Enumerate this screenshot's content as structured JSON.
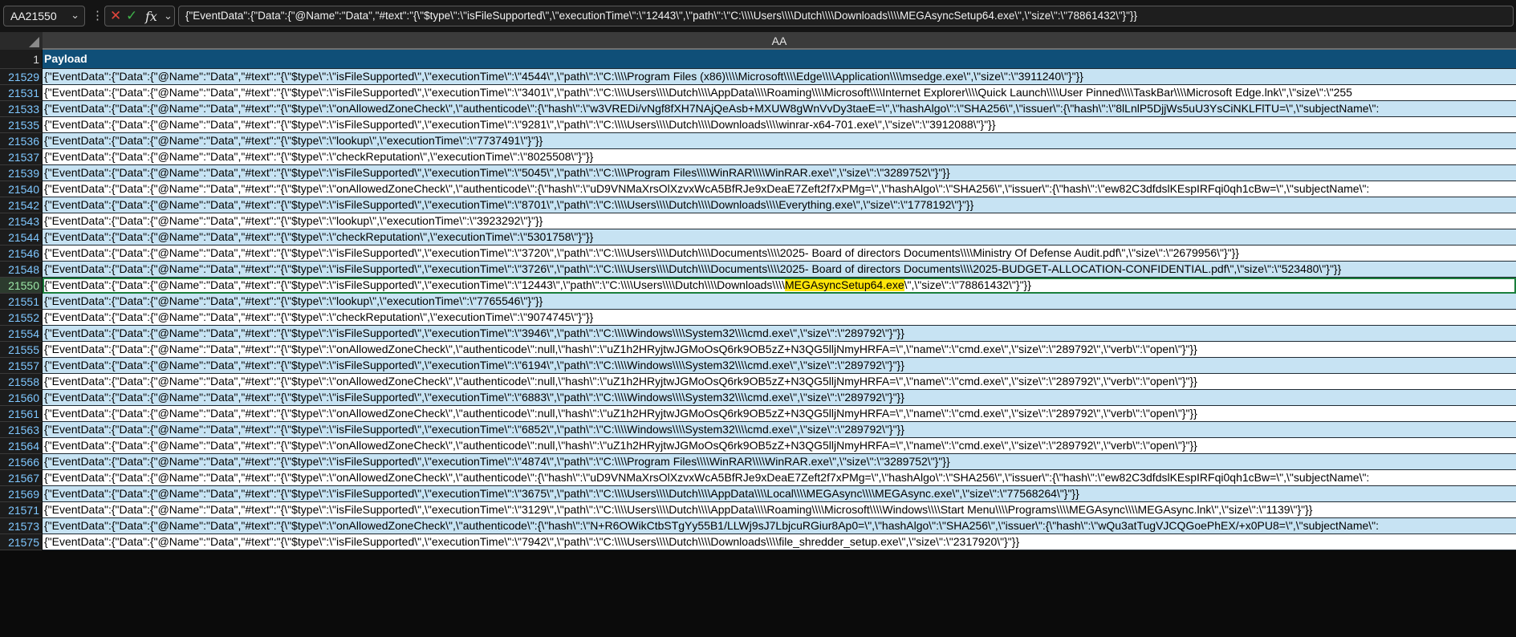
{
  "formula_bar": {
    "name_box": "AA21550",
    "formula": "{\"EventData\":{\"Data\":{\"@Name\":\"Data\",\"#text\":\"{\\\"$type\\\":\\\"isFileSupported\\\",\\\"executionTime\\\":\\\"12443\\\",\\\"path\\\":\\\"C:\\\\\\\\Users\\\\\\\\Dutch\\\\\\\\Downloads\\\\\\\\MEGAsyncSetup64.exe\\\",\\\"size\\\":\\\"78861432\\\"}\"}}"
  },
  "grid": {
    "column_letter": "AA",
    "header_row_number": "1",
    "header_label": "Payload",
    "active_row": "21550",
    "highlight_text": "MEGAsyncSetup64.exe",
    "rows": [
      {
        "num": "21529",
        "style": "blue",
        "text": "{\"EventData\":{\"Data\":{\"@Name\":\"Data\",\"#text\":\"{\\\"$type\\\":\\\"isFileSupported\\\",\\\"executionTime\\\":\\\"4544\\\",\\\"path\\\":\\\"C:\\\\\\\\Program Files (x86)\\\\\\\\Microsoft\\\\\\\\Edge\\\\\\\\Application\\\\\\\\msedge.exe\\\",\\\"size\\\":\\\"3911240\\\"}\"}}"
      },
      {
        "num": "21531",
        "style": "white",
        "text": "{\"EventData\":{\"Data\":{\"@Name\":\"Data\",\"#text\":\"{\\\"$type\\\":\\\"isFileSupported\\\",\\\"executionTime\\\":\\\"3401\\\",\\\"path\\\":\\\"C:\\\\\\\\Users\\\\\\\\Dutch\\\\\\\\AppData\\\\\\\\Roaming\\\\\\\\Microsoft\\\\\\\\Internet Explorer\\\\\\\\Quick Launch\\\\\\\\User Pinned\\\\\\\\TaskBar\\\\\\\\Microsoft Edge.lnk\\\",\\\"size\\\":\\\"255"
      },
      {
        "num": "21533",
        "style": "blue",
        "text": "{\"EventData\":{\"Data\":{\"@Name\":\"Data\",\"#text\":\"{\\\"$type\\\":\\\"onAllowedZoneCheck\\\",\\\"authenticode\\\":{\\\"hash\\\":\\\"w3VREDi/vNgf8fXH7NAjQeAsb+MXUW8gWnVvDy3taeE=\\\",\\\"hashAlgo\\\":\\\"SHA256\\\",\\\"issuer\\\":{\\\"hash\\\":\\\"8lLnlP5DjjWs5uU3YsCiNKLFlTU=\\\",\\\"subjectName\\\":"
      },
      {
        "num": "21535",
        "style": "white",
        "text": "{\"EventData\":{\"Data\":{\"@Name\":\"Data\",\"#text\":\"{\\\"$type\\\":\\\"isFileSupported\\\",\\\"executionTime\\\":\\\"9281\\\",\\\"path\\\":\\\"C:\\\\\\\\Users\\\\\\\\Dutch\\\\\\\\Downloads\\\\\\\\winrar-x64-701.exe\\\",\\\"size\\\":\\\"3912088\\\"}\"}}"
      },
      {
        "num": "21536",
        "style": "blue",
        "text": "{\"EventData\":{\"Data\":{\"@Name\":\"Data\",\"#text\":\"{\\\"$type\\\":\\\"lookup\\\",\\\"executionTime\\\":\\\"7737491\\\"}\"}}"
      },
      {
        "num": "21537",
        "style": "white",
        "text": "{\"EventData\":{\"Data\":{\"@Name\":\"Data\",\"#text\":\"{\\\"$type\\\":\\\"checkReputation\\\",\\\"executionTime\\\":\\\"8025508\\\"}\"}}"
      },
      {
        "num": "21539",
        "style": "blue",
        "text": "{\"EventData\":{\"Data\":{\"@Name\":\"Data\",\"#text\":\"{\\\"$type\\\":\\\"isFileSupported\\\",\\\"executionTime\\\":\\\"5045\\\",\\\"path\\\":\\\"C:\\\\\\\\Program Files\\\\\\\\WinRAR\\\\\\\\WinRAR.exe\\\",\\\"size\\\":\\\"3289752\\\"}\"}}"
      },
      {
        "num": "21540",
        "style": "white",
        "text": "{\"EventData\":{\"Data\":{\"@Name\":\"Data\",\"#text\":\"{\\\"$type\\\":\\\"onAllowedZoneCheck\\\",\\\"authenticode\\\":{\\\"hash\\\":\\\"uD9VNMaXrsOlXzvxWcA5BfRJe9xDeaE7Zeft2f7xPMg=\\\",\\\"hashAlgo\\\":\\\"SHA256\\\",\\\"issuer\\\":{\\\"hash\\\":\\\"ew82C3dfdslKEspIRFqi0qh1cBw=\\\",\\\"subjectName\\\":"
      },
      {
        "num": "21542",
        "style": "blue",
        "text": "{\"EventData\":{\"Data\":{\"@Name\":\"Data\",\"#text\":\"{\\\"$type\\\":\\\"isFileSupported\\\",\\\"executionTime\\\":\\\"8701\\\",\\\"path\\\":\\\"C:\\\\\\\\Users\\\\\\\\Dutch\\\\\\\\Downloads\\\\\\\\Everything.exe\\\",\\\"size\\\":\\\"1778192\\\"}\"}}"
      },
      {
        "num": "21543",
        "style": "white",
        "text": "{\"EventData\":{\"Data\":{\"@Name\":\"Data\",\"#text\":\"{\\\"$type\\\":\\\"lookup\\\",\\\"executionTime\\\":\\\"3923292\\\"}\"}}"
      },
      {
        "num": "21544",
        "style": "blue",
        "text": "{\"EventData\":{\"Data\":{\"@Name\":\"Data\",\"#text\":\"{\\\"$type\\\":\\\"checkReputation\\\",\\\"executionTime\\\":\\\"5301758\\\"}\"}}"
      },
      {
        "num": "21546",
        "style": "white",
        "text": "{\"EventData\":{\"Data\":{\"@Name\":\"Data\",\"#text\":\"{\\\"$type\\\":\\\"isFileSupported\\\",\\\"executionTime\\\":\\\"3720\\\",\\\"path\\\":\\\"C:\\\\\\\\Users\\\\\\\\Dutch\\\\\\\\Documents\\\\\\\\2025- Board of directors Documents\\\\\\\\Ministry Of Defense Audit.pdf\\\",\\\"size\\\":\\\"2679956\\\"}\"}}"
      },
      {
        "num": "21548",
        "style": "blue",
        "text": "{\"EventData\":{\"Data\":{\"@Name\":\"Data\",\"#text\":\"{\\\"$type\\\":\\\"isFileSupported\\\",\\\"executionTime\\\":\\\"3726\\\",\\\"path\\\":\\\"C:\\\\\\\\Users\\\\\\\\Dutch\\\\\\\\Documents\\\\\\\\2025- Board of directors Documents\\\\\\\\2025-BUDGET-ALLOCATION-CONFIDENTIAL.pdf\\\",\\\"size\\\":\\\"523480\\\"}\"}}"
      },
      {
        "num": "21550",
        "style": "active",
        "text_before": "{\"EventData\":{\"Data\":{\"@Name\":\"Data\",\"#text\":\"{\\\"$type\\\":\\\"isFileSupported\\\",\\\"executionTime\\\":\\\"12443\\\",\\\"path\\\":\\\"C:\\\\\\\\Users\\\\\\\\Dutch\\\\\\\\Downloads\\\\\\\\",
        "text_after": "\\\",\\\"size\\\":\\\"78861432\\\"}\"}}"
      },
      {
        "num": "21551",
        "style": "blue",
        "text": "{\"EventData\":{\"Data\":{\"@Name\":\"Data\",\"#text\":\"{\\\"$type\\\":\\\"lookup\\\",\\\"executionTime\\\":\\\"7765546\\\"}\"}}"
      },
      {
        "num": "21552",
        "style": "white",
        "text": "{\"EventData\":{\"Data\":{\"@Name\":\"Data\",\"#text\":\"{\\\"$type\\\":\\\"checkReputation\\\",\\\"executionTime\\\":\\\"9074745\\\"}\"}}"
      },
      {
        "num": "21554",
        "style": "blue",
        "text": "{\"EventData\":{\"Data\":{\"@Name\":\"Data\",\"#text\":\"{\\\"$type\\\":\\\"isFileSupported\\\",\\\"executionTime\\\":\\\"3946\\\",\\\"path\\\":\\\"C:\\\\\\\\Windows\\\\\\\\System32\\\\\\\\cmd.exe\\\",\\\"size\\\":\\\"289792\\\"}\"}}"
      },
      {
        "num": "21555",
        "style": "white",
        "text": "{\"EventData\":{\"Data\":{\"@Name\":\"Data\",\"#text\":\"{\\\"$type\\\":\\\"onAllowedZoneCheck\\\",\\\"authenticode\\\":null,\\\"hash\\\":\\\"uZ1h2HRyjtwJGMoOsQ6rk9OB5zZ+N3QG5lljNmyHRFA=\\\",\\\"name\\\":\\\"cmd.exe\\\",\\\"size\\\":\\\"289792\\\",\\\"verb\\\":\\\"open\\\"}\"}}"
      },
      {
        "num": "21557",
        "style": "blue",
        "text": "{\"EventData\":{\"Data\":{\"@Name\":\"Data\",\"#text\":\"{\\\"$type\\\":\\\"isFileSupported\\\",\\\"executionTime\\\":\\\"6194\\\",\\\"path\\\":\\\"C:\\\\\\\\Windows\\\\\\\\System32\\\\\\\\cmd.exe\\\",\\\"size\\\":\\\"289792\\\"}\"}}"
      },
      {
        "num": "21558",
        "style": "white",
        "text": "{\"EventData\":{\"Data\":{\"@Name\":\"Data\",\"#text\":\"{\\\"$type\\\":\\\"onAllowedZoneCheck\\\",\\\"authenticode\\\":null,\\\"hash\\\":\\\"uZ1h2HRyjtwJGMoOsQ6rk9OB5zZ+N3QG5lljNmyHRFA=\\\",\\\"name\\\":\\\"cmd.exe\\\",\\\"size\\\":\\\"289792\\\",\\\"verb\\\":\\\"open\\\"}\"}}"
      },
      {
        "num": "21560",
        "style": "blue",
        "text": "{\"EventData\":{\"Data\":{\"@Name\":\"Data\",\"#text\":\"{\\\"$type\\\":\\\"isFileSupported\\\",\\\"executionTime\\\":\\\"6883\\\",\\\"path\\\":\\\"C:\\\\\\\\Windows\\\\\\\\System32\\\\\\\\cmd.exe\\\",\\\"size\\\":\\\"289792\\\"}\"}}"
      },
      {
        "num": "21561",
        "style": "white",
        "text": "{\"EventData\":{\"Data\":{\"@Name\":\"Data\",\"#text\":\"{\\\"$type\\\":\\\"onAllowedZoneCheck\\\",\\\"authenticode\\\":null,\\\"hash\\\":\\\"uZ1h2HRyjtwJGMoOsQ6rk9OB5zZ+N3QG5lljNmyHRFA=\\\",\\\"name\\\":\\\"cmd.exe\\\",\\\"size\\\":\\\"289792\\\",\\\"verb\\\":\\\"open\\\"}\"}}"
      },
      {
        "num": "21563",
        "style": "blue",
        "text": "{\"EventData\":{\"Data\":{\"@Name\":\"Data\",\"#text\":\"{\\\"$type\\\":\\\"isFileSupported\\\",\\\"executionTime\\\":\\\"6852\\\",\\\"path\\\":\\\"C:\\\\\\\\Windows\\\\\\\\System32\\\\\\\\cmd.exe\\\",\\\"size\\\":\\\"289792\\\"}\"}}"
      },
      {
        "num": "21564",
        "style": "white",
        "text": "{\"EventData\":{\"Data\":{\"@Name\":\"Data\",\"#text\":\"{\\\"$type\\\":\\\"onAllowedZoneCheck\\\",\\\"authenticode\\\":null,\\\"hash\\\":\\\"uZ1h2HRyjtwJGMoOsQ6rk9OB5zZ+N3QG5lljNmyHRFA=\\\",\\\"name\\\":\\\"cmd.exe\\\",\\\"size\\\":\\\"289792\\\",\\\"verb\\\":\\\"open\\\"}\"}}"
      },
      {
        "num": "21566",
        "style": "blue",
        "text": "{\"EventData\":{\"Data\":{\"@Name\":\"Data\",\"#text\":\"{\\\"$type\\\":\\\"isFileSupported\\\",\\\"executionTime\\\":\\\"4874\\\",\\\"path\\\":\\\"C:\\\\\\\\Program Files\\\\\\\\WinRAR\\\\\\\\WinRAR.exe\\\",\\\"size\\\":\\\"3289752\\\"}\"}}"
      },
      {
        "num": "21567",
        "style": "white",
        "text": "{\"EventData\":{\"Data\":{\"@Name\":\"Data\",\"#text\":\"{\\\"$type\\\":\\\"onAllowedZoneCheck\\\",\\\"authenticode\\\":{\\\"hash\\\":\\\"uD9VNMaXrsOlXzvxWcA5BfRJe9xDeaE7Zeft2f7xPMg=\\\",\\\"hashAlgo\\\":\\\"SHA256\\\",\\\"issuer\\\":{\\\"hash\\\":\\\"ew82C3dfdslKEspIRFqi0qh1cBw=\\\",\\\"subjectName\\\":"
      },
      {
        "num": "21569",
        "style": "blue",
        "text": "{\"EventData\":{\"Data\":{\"@Name\":\"Data\",\"#text\":\"{\\\"$type\\\":\\\"isFileSupported\\\",\\\"executionTime\\\":\\\"3675\\\",\\\"path\\\":\\\"C:\\\\\\\\Users\\\\\\\\Dutch\\\\\\\\AppData\\\\\\\\Local\\\\\\\\MEGAsync\\\\\\\\MEGAsync.exe\\\",\\\"size\\\":\\\"77568264\\\"}\"}}"
      },
      {
        "num": "21571",
        "style": "white",
        "text": "{\"EventData\":{\"Data\":{\"@Name\":\"Data\",\"#text\":\"{\\\"$type\\\":\\\"isFileSupported\\\",\\\"executionTime\\\":\\\"3129\\\",\\\"path\\\":\\\"C:\\\\\\\\Users\\\\\\\\Dutch\\\\\\\\AppData\\\\\\\\Roaming\\\\\\\\Microsoft\\\\\\\\Windows\\\\\\\\Start Menu\\\\\\\\Programs\\\\\\\\MEGAsync\\\\\\\\MEGAsync.lnk\\\",\\\"size\\\":\\\"1139\\\"}\"}}"
      },
      {
        "num": "21573",
        "style": "blue",
        "text": "{\"EventData\":{\"Data\":{\"@Name\":\"Data\",\"#text\":\"{\\\"$type\\\":\\\"onAllowedZoneCheck\\\",\\\"authenticode\\\":{\\\"hash\\\":\\\"N+R6OWikCtbSTgYy55B1/LLWj9sJ7LbjcuRGiur8Ap0=\\\",\\\"hashAlgo\\\":\\\"SHA256\\\",\\\"issuer\\\":{\\\"hash\\\":\\\"wQu3atTugVJCQGoePhEX/+x0PU8=\\\",\\\"subjectName\\\":"
      },
      {
        "num": "21575",
        "style": "white",
        "text": "{\"EventData\":{\"Data\":{\"@Name\":\"Data\",\"#text\":\"{\\\"$type\\\":\\\"isFileSupported\\\",\\\"executionTime\\\":\\\"7942\\\",\\\"path\\\":\\\"C:\\\\\\\\Users\\\\\\\\Dutch\\\\\\\\Downloads\\\\\\\\file_shredder_setup.exe\\\",\\\"size\\\":\\\"2317920\\\"}\"}}"
      }
    ]
  }
}
